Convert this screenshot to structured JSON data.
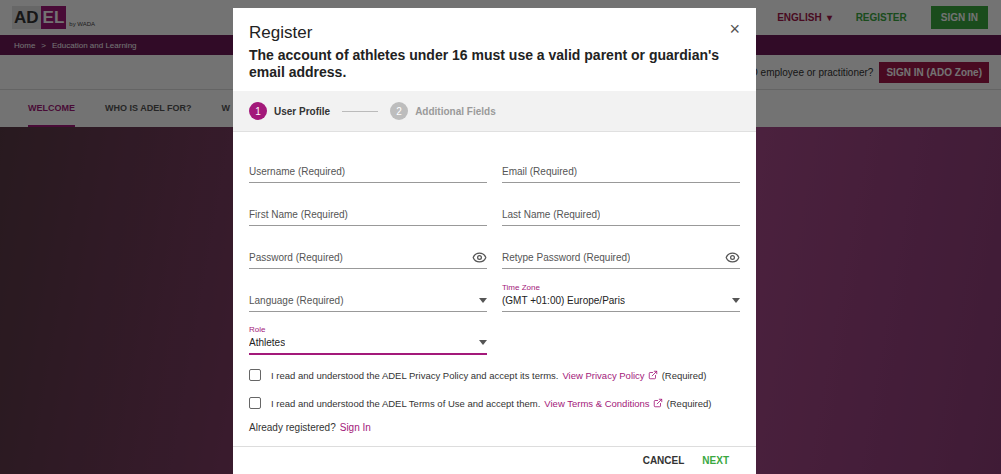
{
  "header": {
    "logo": [
      "AD",
      "EL"
    ],
    "logo_by": "by WADA",
    "language": "ENGLISH",
    "language_caret": "▾",
    "register": "REGISTER",
    "sign_in": "SIGN IN"
  },
  "breadcrumb": [
    {
      "label": "Home"
    },
    {
      "label": "Education and Learning"
    }
  ],
  "breadcrumb_separator": ">",
  "ado_bar": {
    "prompt": "ADO employee or practitioner?",
    "button": "SIGN IN (ADO Zone)"
  },
  "nav": [
    {
      "label": "WELCOME",
      "selected": true
    },
    {
      "label": "WHO IS ADEL FOR?",
      "selected": false
    },
    {
      "label": "W",
      "selected": false
    }
  ],
  "dialog": {
    "title": "Register",
    "notice": "The account of athletes under 16 must use a valid parent or guardian's email address.",
    "close": "×",
    "steps": [
      {
        "number": "1",
        "label": "User Profile",
        "selected": true
      },
      {
        "number": "2",
        "label": "Additional Fields",
        "selected": false
      }
    ],
    "fields": [
      {
        "label": "Username (Required)",
        "kind": "text",
        "value": "",
        "focused": false
      },
      {
        "label": "Email (Required)",
        "kind": "text",
        "value": "",
        "focused": false
      },
      {
        "label": "First Name (Required)",
        "kind": "text",
        "value": "",
        "focused": false
      },
      {
        "label": "Last Name (Required)",
        "kind": "text",
        "value": "",
        "focused": false
      },
      {
        "label": "Password (Required)",
        "kind": "password",
        "value": "",
        "focused": false
      },
      {
        "label": "Retype Password (Required)",
        "kind": "password",
        "value": "",
        "focused": false
      },
      {
        "label": "Language (Required)",
        "kind": "select",
        "value": "",
        "focused": false
      },
      {
        "label": "Time Zone",
        "kind": "select",
        "value": "(GMT +01:00) Europe/Paris",
        "focused": false
      },
      {
        "label": "Role",
        "kind": "select",
        "value": "Athletes",
        "focused": true
      }
    ],
    "agreements": [
      {
        "text": "I read and understood the ADEL Privacy Policy and accept its terms.",
        "link": "View Privacy Policy",
        "required": "(Required)",
        "checked": false
      },
      {
        "text": "I read and understood the ADEL Terms of Use and accept them.",
        "link": "View Terms & Conditions",
        "required": "(Required)",
        "checked": false
      }
    ],
    "signin_prompt": "Already registered?",
    "signin_link": "Sign In",
    "buttons": [
      {
        "label": "CANCEL",
        "kind": "secondary"
      },
      {
        "label": "NEXT",
        "kind": "primary"
      }
    ]
  }
}
